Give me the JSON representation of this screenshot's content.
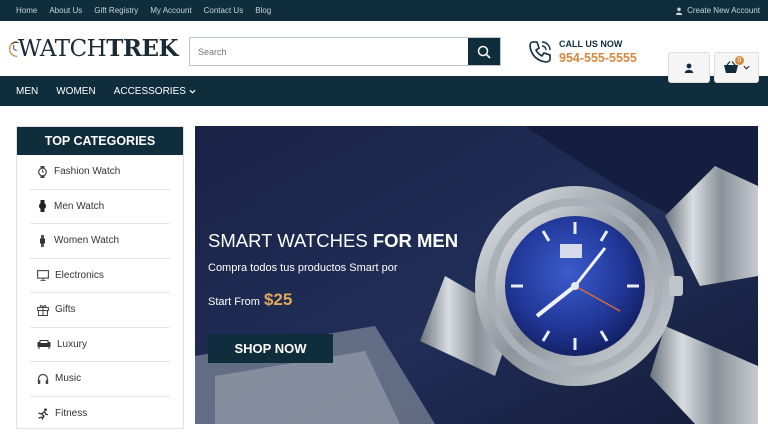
{
  "topbar": {
    "links": [
      "Home",
      "About Us",
      "Gift Registry",
      "My Account",
      "Contact Us",
      "Blog"
    ],
    "account_link": "Create New Account"
  },
  "header": {
    "logo_watch": "WATCH",
    "logo_trek": "TREK",
    "search_placeholder": "Search",
    "call_label": "CALL US NOW",
    "phone": "954-555-5555",
    "cart_count": "0"
  },
  "nav": {
    "items": [
      {
        "label": "MEN"
      },
      {
        "label": "WOMEN"
      },
      {
        "label": "ACCESSORIES"
      }
    ]
  },
  "categories": {
    "title": "TOP CATEGORIES",
    "items": [
      {
        "label": "Fashion Watch",
        "icon": "fashion-watch-icon"
      },
      {
        "label": "Men Watch",
        "icon": "men-watch-icon"
      },
      {
        "label": "Women Watch",
        "icon": "women-watch-icon"
      },
      {
        "label": "Electronics",
        "icon": "monitor-icon"
      },
      {
        "label": "Gifts",
        "icon": "gift-icon"
      },
      {
        "label": "Luxury",
        "icon": "sofa-icon"
      },
      {
        "label": "Music",
        "icon": "headphones-icon"
      },
      {
        "label": "Fitness",
        "icon": "fitness-icon"
      }
    ]
  },
  "banner": {
    "title_light": "SMART WATCHES",
    "title_bold": "FOR MEN",
    "subtitle": "Compra todos tus productos Smart por",
    "start_from": "Start From",
    "price": "$25",
    "button": "SHOP NOW"
  },
  "colors": {
    "navy": "#0f2d3d",
    "accent": "#d1893f"
  }
}
